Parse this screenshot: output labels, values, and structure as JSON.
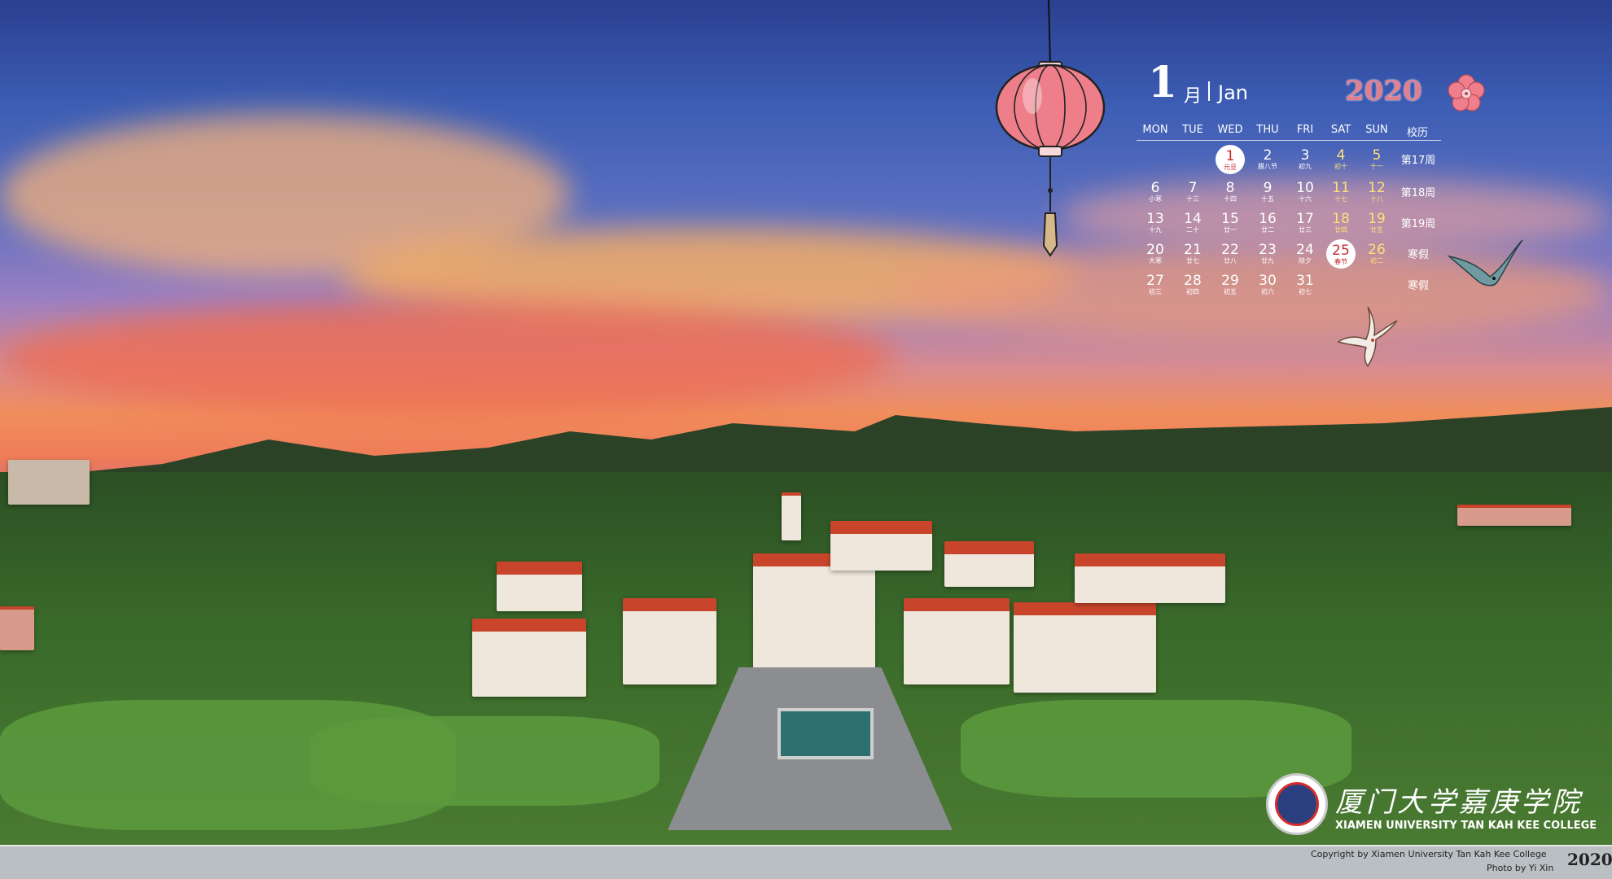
{
  "calendar": {
    "month_number": "1",
    "month_cn": "月",
    "month_en": "Jan",
    "year": "2020",
    "weekdays": [
      "MON",
      "TUE",
      "WED",
      "THU",
      "FRI",
      "SAT",
      "SUN"
    ],
    "week_header": "校历",
    "rows": [
      {
        "week": "第17周",
        "cells": [
          null,
          null,
          {
            "d": "1",
            "l": "元旦",
            "type": "hl"
          },
          {
            "d": "2",
            "l": "腊八节",
            "type": ""
          },
          {
            "d": "3",
            "l": "初九",
            "type": ""
          },
          {
            "d": "4",
            "l": "初十",
            "type": "wk"
          },
          {
            "d": "5",
            "l": "十一",
            "type": "wk"
          }
        ]
      },
      {
        "week": "第18周",
        "cells": [
          {
            "d": "6",
            "l": "小寒",
            "type": ""
          },
          {
            "d": "7",
            "l": "十三",
            "type": ""
          },
          {
            "d": "8",
            "l": "十四",
            "type": ""
          },
          {
            "d": "9",
            "l": "十五",
            "type": ""
          },
          {
            "d": "10",
            "l": "十六",
            "type": ""
          },
          {
            "d": "11",
            "l": "十七",
            "type": "wk"
          },
          {
            "d": "12",
            "l": "十八",
            "type": "wk"
          }
        ]
      },
      {
        "week": "第19周",
        "cells": [
          {
            "d": "13",
            "l": "十九",
            "type": ""
          },
          {
            "d": "14",
            "l": "二十",
            "type": ""
          },
          {
            "d": "15",
            "l": "廿一",
            "type": ""
          },
          {
            "d": "16",
            "l": "廿二",
            "type": ""
          },
          {
            "d": "17",
            "l": "廿三",
            "type": ""
          },
          {
            "d": "18",
            "l": "廿四",
            "type": "wk"
          },
          {
            "d": "19",
            "l": "廿五",
            "type": "wk"
          }
        ]
      },
      {
        "week": "寒假",
        "cells": [
          {
            "d": "20",
            "l": "大寒",
            "type": ""
          },
          {
            "d": "21",
            "l": "廿七",
            "type": ""
          },
          {
            "d": "22",
            "l": "廿八",
            "type": ""
          },
          {
            "d": "23",
            "l": "廿九",
            "type": ""
          },
          {
            "d": "24",
            "l": "除夕",
            "type": ""
          },
          {
            "d": "25",
            "l": "春节",
            "type": "hl"
          },
          {
            "d": "26",
            "l": "初二",
            "type": "wk"
          }
        ]
      },
      {
        "week": "寒假",
        "cells": [
          {
            "d": "27",
            "l": "初三",
            "type": ""
          },
          {
            "d": "28",
            "l": "初四",
            "type": ""
          },
          {
            "d": "29",
            "l": "初五",
            "type": ""
          },
          {
            "d": "30",
            "l": "初六",
            "type": ""
          },
          {
            "d": "31",
            "l": "初七",
            "type": ""
          },
          null,
          null
        ]
      }
    ]
  },
  "branding": {
    "name_cn": "厦门大学嘉庚学院",
    "name_en": "XIAMEN UNIVERSITY TAN KAH KEE COLLEGE",
    "copyright": "Copyright  by  Xiamen  University  Tan  Kah  Kee  College",
    "photo": "Photo  by  Yi  Xin",
    "year": "2020"
  },
  "colors": {
    "year_pink": "#e27f8e",
    "highlight_red": "#c8282d",
    "weekend_yellow": "#ffe07a",
    "roof_red": "#c8452b"
  },
  "icons": [
    "lantern-icon",
    "plum-blossom-icon",
    "swallow-bird-icon",
    "college-logo-icon"
  ]
}
